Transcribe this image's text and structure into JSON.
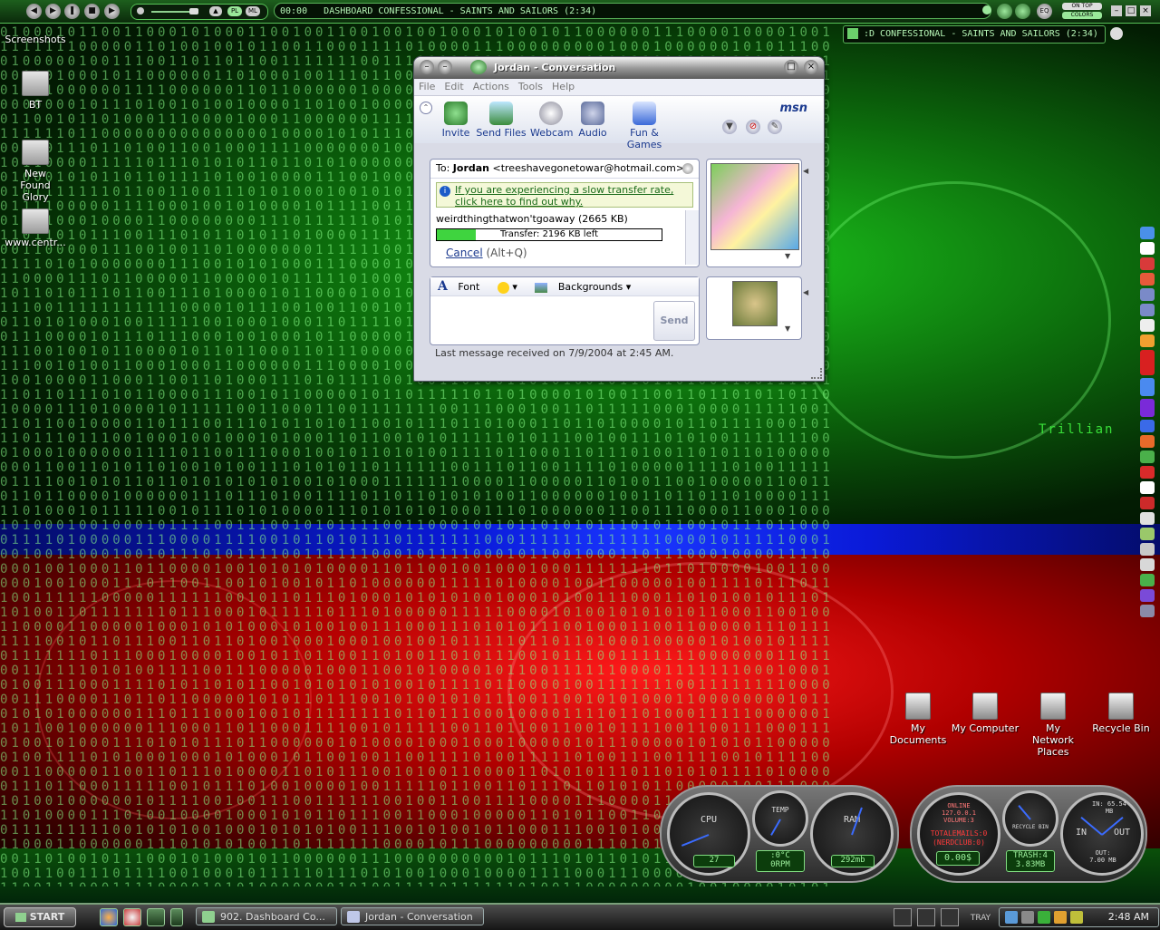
{
  "winamp": {
    "time": "00:00",
    "track": "DASHBOARD CONFESSIONAL - SAINTS AND SAILORS (2:34)",
    "btn_pl": "PL",
    "btn_ml": "ML",
    "btn_ontop": "ON TOP",
    "btn_colors": "COLORS",
    "btn_eq": "EQ"
  },
  "mini_player": {
    "track": ":D CONFESSIONAL - SAINTS AND SAILORS (2:34)"
  },
  "desktop_left": [
    {
      "label": "Screenshots"
    },
    {
      "label": "BT"
    },
    {
      "label": "New Found Glory"
    },
    {
      "label": "www.centr..."
    }
  ],
  "trillian_label": "Trillian",
  "msn": {
    "title": "Jordan - Conversation",
    "menu": [
      "File",
      "Edit",
      "Actions",
      "Tools",
      "Help"
    ],
    "tools": [
      {
        "label": "Invite",
        "icon": "invite-icon"
      },
      {
        "label": "Send Files",
        "icon": "send-files-icon"
      },
      {
        "label": "Webcam",
        "icon": "webcam-icon"
      },
      {
        "label": "Audio",
        "icon": "audio-icon"
      },
      {
        "label": "Fun & Games",
        "icon": "fun-games-icon"
      }
    ],
    "logo": "msn",
    "to_label": "To:",
    "to_name": "Jordan",
    "to_email": "<treeshavegonetowar@hotmail.com>",
    "notice": "If you are experiencing a slow transfer rate, click here to find out why.",
    "file_name": "weirdthingthatwon'tgoaway (2665 KB)",
    "transfer_text": "Transfer: 2196 KB left",
    "transfer_progress": 0.175,
    "cancel_label": "Cancel",
    "cancel_hint": "(Alt+Q)",
    "font_label": "Font",
    "backgrounds_label": "Backgrounds",
    "send_label": "Send",
    "status": "Last message received on 7/9/2004 at 2:45 AM."
  },
  "desktop_right": [
    {
      "label": "My Documents"
    },
    {
      "label": "My Computer"
    },
    {
      "label": "My Network Places"
    },
    {
      "label": "Recycle Bin"
    }
  ],
  "gauges_left": {
    "cpu_label": "CPU",
    "cpu_value": "27",
    "temp_label": "TEMP",
    "temp_value": ":0°C",
    "temp_rpm": "0RPM",
    "ram_label": "RAM",
    "ram_value": "292mb"
  },
  "gauges_right": {
    "online": "ONLINE",
    "ip": "127.0.0.1",
    "volume": "VOLUME:3",
    "emails": "TOTALEMAILS:0",
    "nerdclub": "(NERDCLUB:0)",
    "money": "0.00$",
    "recycle_label": "RECYCLE BIN",
    "trash": "TRASH:4",
    "trash_size": "3.83MB",
    "in_label": "IN",
    "out_label": "OUT",
    "in_value": "IN: 65.54 MB",
    "out_value": "OUT: 7.00 MB"
  },
  "taskbar": {
    "start": "START",
    "tasks": [
      {
        "label": "902. Dashboard Co..."
      },
      {
        "label": "Jordan - Conversation"
      }
    ],
    "tray_label": "TRAY",
    "clock": "2:48 AM"
  },
  "colors": {
    "matrix_green": "#8cff8c",
    "band_blue": "#0a1ad8",
    "band_red": "#c80000",
    "msn_blue": "#1b3a8f",
    "progress_green": "#3fd43f"
  }
}
